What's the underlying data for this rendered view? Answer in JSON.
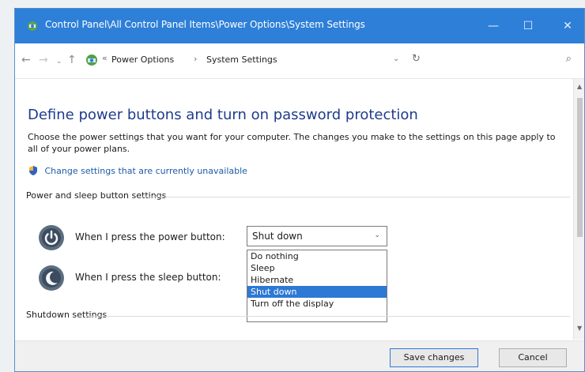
{
  "window": {
    "title": "Control Panel\\All Control Panel Items\\Power Options\\System Settings",
    "minimize_glyph": "—",
    "maximize_glyph": "☐",
    "close_glyph": "✕"
  },
  "addressbar": {
    "prefix": "«",
    "breadcrumb_1": "Power Options",
    "separator": "›",
    "breadcrumb_2": "System Settings",
    "dropdown_glyph": "⌄",
    "refresh_glyph": "↻",
    "search_glyph": "⌕"
  },
  "page": {
    "title": "Define power buttons and turn on password protection",
    "description": "Choose the power settings that you want for your computer. The changes you make to the settings on this page apply to all of your power plans.",
    "change_link": "Change settings that are currently unavailable"
  },
  "sections": {
    "power_sleep": "Power and sleep button settings",
    "shutdown": "Shutdown settings"
  },
  "settings": {
    "power_button_label": "When I press the power button:",
    "sleep_button_label": "When I press the sleep button:",
    "power_button_value": "Shut down",
    "options": [
      "Do nothing",
      "Sleep",
      "Hibernate",
      "Shut down",
      "Turn off the display"
    ]
  },
  "buttons": {
    "save": "Save changes",
    "cancel": "Cancel"
  },
  "colors": {
    "titlebar": "#2d7fd8",
    "heading": "#1e3c8c",
    "link": "#1e5ba8",
    "selection": "#2d79d5"
  },
  "icons": {
    "titlebar": "control-panel-icon",
    "breadcrumb": "control-panel-icon",
    "shield": "shield-icon",
    "power": "power-icon",
    "sleep": "sleep-icon"
  }
}
